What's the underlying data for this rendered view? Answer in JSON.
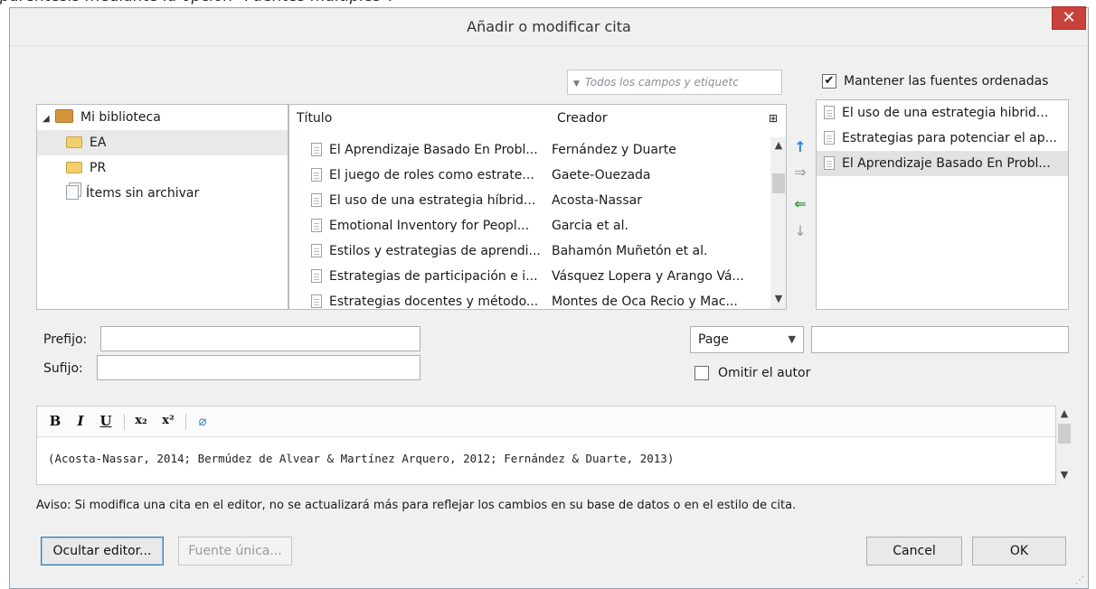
{
  "background_caption": "paréntesis mediante la opción \"Fuentes múltiples\".",
  "dialog": {
    "title": "Añadir o modificar cita",
    "close_glyph": "✕"
  },
  "search": {
    "placeholder": "Todos los campos y etiquetc"
  },
  "keep_sorted": {
    "label": "Mantener las fuentes ordenadas",
    "checked": true
  },
  "library": {
    "root": "Mi biblioteca",
    "collections": [
      {
        "label": "EA",
        "selected": true
      },
      {
        "label": "PR",
        "selected": false
      }
    ],
    "unfiled": "Ítems sin archivar"
  },
  "items": {
    "columns": {
      "title": "Título",
      "creator": "Creador"
    },
    "rows": [
      {
        "title": "El Aprendizaje Basado En Probl...",
        "creator": "Fernández y Duarte"
      },
      {
        "title": "El juego de roles como estrate...",
        "creator": "Gaete-Ouezada"
      },
      {
        "title": "El uso de una estrategia híbrid...",
        "creator": "Acosta-Nassar"
      },
      {
        "title": "Emotional Inventory for Peopl...",
        "creator": "Garcia et al."
      },
      {
        "title": "Estilos y estrategias de aprendi...",
        "creator": "Bahamón Muñetón et al."
      },
      {
        "title": "Estrategias de participación e i...",
        "creator": "Vásquez Lopera y Arango Vá..."
      },
      {
        "title": "Estrategias docentes y método...",
        "creator": "Montes de Oca Recio y Mac..."
      }
    ]
  },
  "selected_sources": [
    {
      "title": "El uso de una estrategia hibrid...",
      "selected": false
    },
    {
      "title": "Estrategias para potenciar el ap...",
      "selected": false
    },
    {
      "title": "El Aprendizaje Basado En Probl...",
      "selected": true
    }
  ],
  "fields": {
    "prefix_label": "Prefijo:",
    "prefix_value": "",
    "suffix_label": "Sufijo:",
    "suffix_value": "",
    "locator_type": "Page",
    "locator_value": "",
    "omit_author_label": "Omitir el autor",
    "omit_author_checked": false
  },
  "editor": {
    "toolbar": {
      "bold": "B",
      "italic": "I",
      "underline": "U",
      "subscript": "x₂",
      "superscript": "x²"
    },
    "text": "(Acosta-Nassar, 2014; Bermúdez de Alvear & Martínez Arquero, 2012; Fernández & Duarte, 2013)"
  },
  "warning": "Aviso: Si modifica una cita en el editor, no se actualizará más para reflejar los cambios en su base de datos o en el estilo de cita.",
  "buttons": {
    "hide_editor": "Ocultar editor...",
    "single_source": "Fuente única...",
    "cancel": "Cancel",
    "ok": "OK"
  },
  "colors": {
    "close_button": "#c9413c",
    "add_arrow": "#2b7fd9",
    "remove_arrow": "#3a9a3a"
  }
}
